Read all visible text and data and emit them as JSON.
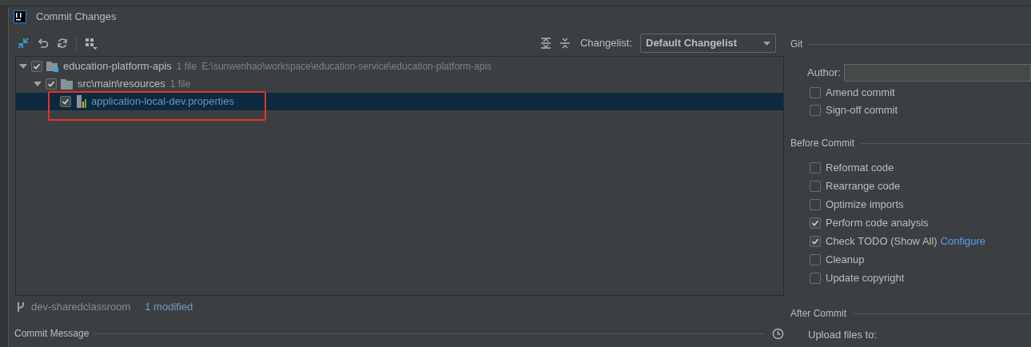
{
  "window": {
    "title": "Commit Changes"
  },
  "toolbar": {
    "changelist_label": "Changelist:",
    "changelist_value": "Default Changelist"
  },
  "tree": [
    {
      "kind": "module",
      "name": "education-platform-apis",
      "count": "1 file",
      "path": "E:\\sunwenhao\\workspace\\education-service\\education-platform-apis",
      "checked": true,
      "expanded": true,
      "selected": false,
      "children": [
        {
          "kind": "folder",
          "name": "src\\main\\resources",
          "count": "1 file",
          "checked": true,
          "expanded": true,
          "selected": false,
          "children": [
            {
              "kind": "file",
              "name": "application-local-dev.properties",
              "checked": true,
              "selected": true,
              "highlighted": true
            }
          ]
        }
      ]
    }
  ],
  "status": {
    "branch": "dev-sharedclassroom",
    "modified": "1 modified"
  },
  "commit_message": {
    "label": "Commit Message"
  },
  "git": {
    "title": "Git",
    "author_label": "Author:",
    "options": [
      {
        "label": "Amend commit",
        "checked": false
      },
      {
        "label": "Sign-off commit",
        "checked": false
      }
    ]
  },
  "before_commit": {
    "title": "Before Commit",
    "options": [
      {
        "label": "Reformat code",
        "checked": false
      },
      {
        "label": "Rearrange code",
        "checked": false
      },
      {
        "label": "Optimize imports",
        "checked": false
      },
      {
        "label": "Perform code analysis",
        "checked": true
      },
      {
        "label": "Check TODO (Show All)",
        "checked": true,
        "link": "Configure"
      },
      {
        "label": "Cleanup",
        "checked": false
      },
      {
        "label": "Update copyright",
        "checked": false
      }
    ]
  },
  "after_commit": {
    "title": "After Commit",
    "upload_label": "Upload files to:"
  }
}
